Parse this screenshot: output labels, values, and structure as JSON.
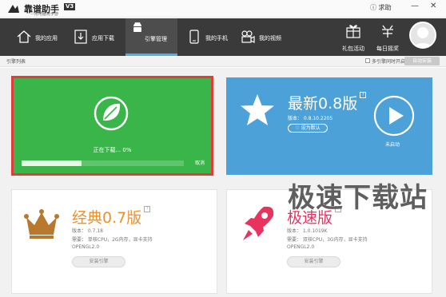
{
  "titlebar": {
    "app_name": "靠谱助手",
    "version_badge": "V3",
    "slogan": "—用电脑玩手游",
    "help_label": "求助",
    "help_icon": "help-circle-icon",
    "min_icon": "minimize-icon",
    "close_icon": "close-icon"
  },
  "nav": {
    "items": [
      {
        "label": "我的应用",
        "icon": "home-icon"
      },
      {
        "label": "应用下载",
        "icon": "download-icon"
      },
      {
        "label": "引擎管理",
        "icon": "android-icon"
      },
      {
        "label": "我的手机",
        "icon": "phone-icon"
      },
      {
        "label": "我的视频",
        "icon": "video-camera-icon"
      }
    ],
    "active_index": 2,
    "gift_label": "礼包活动",
    "daily_label": "每日摇奖"
  },
  "subbar": {
    "title": "引擎列表",
    "multi_engine_label": "多引擎同时开启",
    "auto_install_label": "自动安装"
  },
  "engines": {
    "downloading": {
      "status": "正在下载... 0%",
      "progress": 0.37,
      "cancel_label": "取消"
    },
    "latest": {
      "title": "最新0.8版",
      "version": "版本： 0.8.10.2205",
      "set_default_label": "设为默认",
      "status": "未启动"
    },
    "classic": {
      "title": "经典0.7版",
      "version": "版本： 0.7.18",
      "req1": "需要： 单核CPU，2G内存，显卡支持",
      "req2": "OPENGL2.0",
      "install_label": "安装引擎",
      "color": "#e89233"
    },
    "fast": {
      "title": "极速版",
      "version": "版本： 1.0.1019K",
      "req1": "需要： 双核CPU，3G内存，显卡支持",
      "req2": "OPENGL2.0",
      "install_label": "安装引擎",
      "color": "#e8335f"
    }
  },
  "watermark": "极速下载站"
}
